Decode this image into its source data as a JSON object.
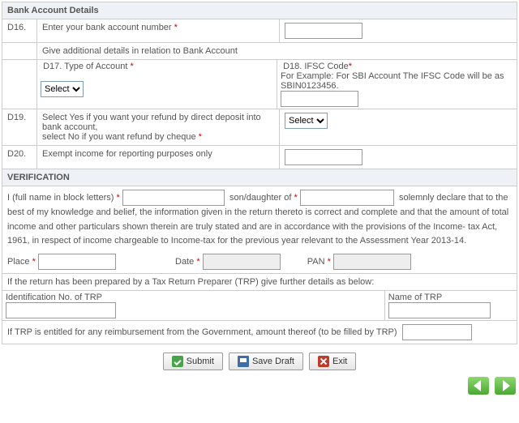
{
  "sections": {
    "bank_header": "Bank Account Details",
    "d16": {
      "num": "D16.",
      "label": "Enter your bank account number",
      "req": "*"
    },
    "additional": "Give additional details in relation to Bank Account",
    "d17": {
      "label": "D17. Type of Account",
      "req": "*",
      "select_default": "Select"
    },
    "d18": {
      "label": "D18. IFSC Code",
      "req": "*",
      "hint": "For Example: For SBI Account The IFSC Code will be as SBIN0123456."
    },
    "d19": {
      "num": "D19.",
      "line1": "Select Yes if you want your refund by direct deposit into bank account,",
      "line2": "select No if you want refund by cheque",
      "req": "*",
      "select_default": "Select"
    },
    "d20": {
      "num": "D20.",
      "label": "Exempt income for reporting purposes only"
    },
    "verif_header": "VERIFICATION",
    "verif": {
      "p1a": "I (full name in block letters)",
      "p1b": "son/daughter of",
      "p1c": "solemnly declare that to the best of my knowledge and belief, the information given in the return thereto is correct and complete and that the amount of total income and other particulars shown therein are truly stated and are in accordance with the provisions of the Income- tax Act, 1961, in respect of income chargeable to Income-tax for the previous year relevant to the Assessment Year 2013-14.",
      "place": "Place",
      "date": "Date",
      "pan": "PAN"
    },
    "trp_intro": "If the return has been prepared by a Tax Return Preparer (TRP) give further details as below:",
    "trp_id": "Identification No. of TRP",
    "trp_name": "Name of TRP",
    "trp_reimb": "If TRP is entitled for any reimbursement from the Government, amount thereof (to be filled by TRP)"
  },
  "buttons": {
    "submit": "Submit",
    "save": "Save Draft",
    "exit": "Exit"
  }
}
